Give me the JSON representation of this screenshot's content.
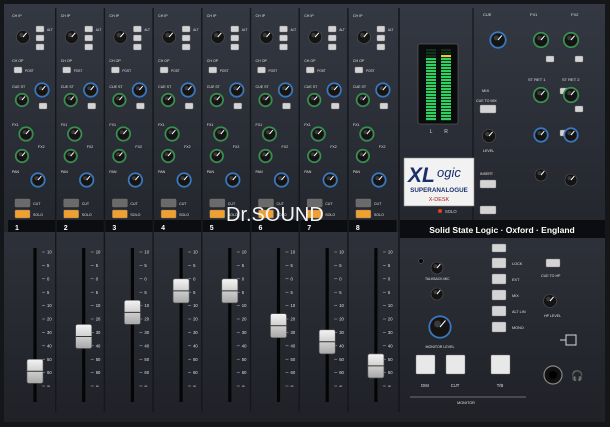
{
  "desk": {
    "channels": [
      "1",
      "2",
      "3",
      "4",
      "5",
      "6",
      "7",
      "8"
    ],
    "fader_levels": [
      0.08,
      0.34,
      0.52,
      0.68,
      0.68,
      0.42,
      0.3,
      0.12
    ],
    "fader_scale": [
      "10",
      "5",
      "0",
      "5",
      "10",
      "20",
      "30",
      "40",
      "50",
      "60",
      "∞"
    ],
    "strip_labels": {
      "ch_ip": "CH IP",
      "ch_op": "CH OP",
      "post": "POST",
      "cue_st": "CUE ST",
      "fx1": "FX1",
      "fx2": "FX2",
      "pan": "PAN",
      "cut": "CUT",
      "solo": "SOLO",
      "alt": "ALT"
    },
    "meter_labels": [
      "L",
      "R"
    ],
    "logo": {
      "xl": "XL",
      "ogic": "ogic",
      "super": "SUPERANALOGUE",
      "desk": "X-DESK"
    },
    "solo_indicator": "SOLO",
    "brand": "Solid State Logic  ·  Oxford  ·  England",
    "watermark": "Dr.SOUND",
    "master": {
      "cue_to_mix": "CUE TO MIX",
      "level": "LEVEL",
      "insert": "INSERT",
      "mix": "MIX",
      "sources": [
        "LOCK",
        "EXT",
        "MIX",
        "ALT LIN",
        "MONO"
      ],
      "monitor_level": "MONITOR LEVEL",
      "talkback_mic": "TALKBACK MIC",
      "dim": "DIM",
      "cut": "CUT",
      "tb": "T/B",
      "monitor": "MONITOR",
      "cue_to_hp": "CUE TO HP",
      "hp_level": "HP LEVEL"
    },
    "returns": {
      "cue": "CUE",
      "fx1": "FX1",
      "fx2": "FX2",
      "st_ret_1": "ST RET 1",
      "st_ret_2": "ST RET 2"
    },
    "colors": {
      "panel": "#2a2d35",
      "knob_green": "#2f9a4a",
      "knob_blue": "#2f7fd8",
      "cut_led": "#f0a030",
      "solo_led": "#e84018"
    }
  }
}
